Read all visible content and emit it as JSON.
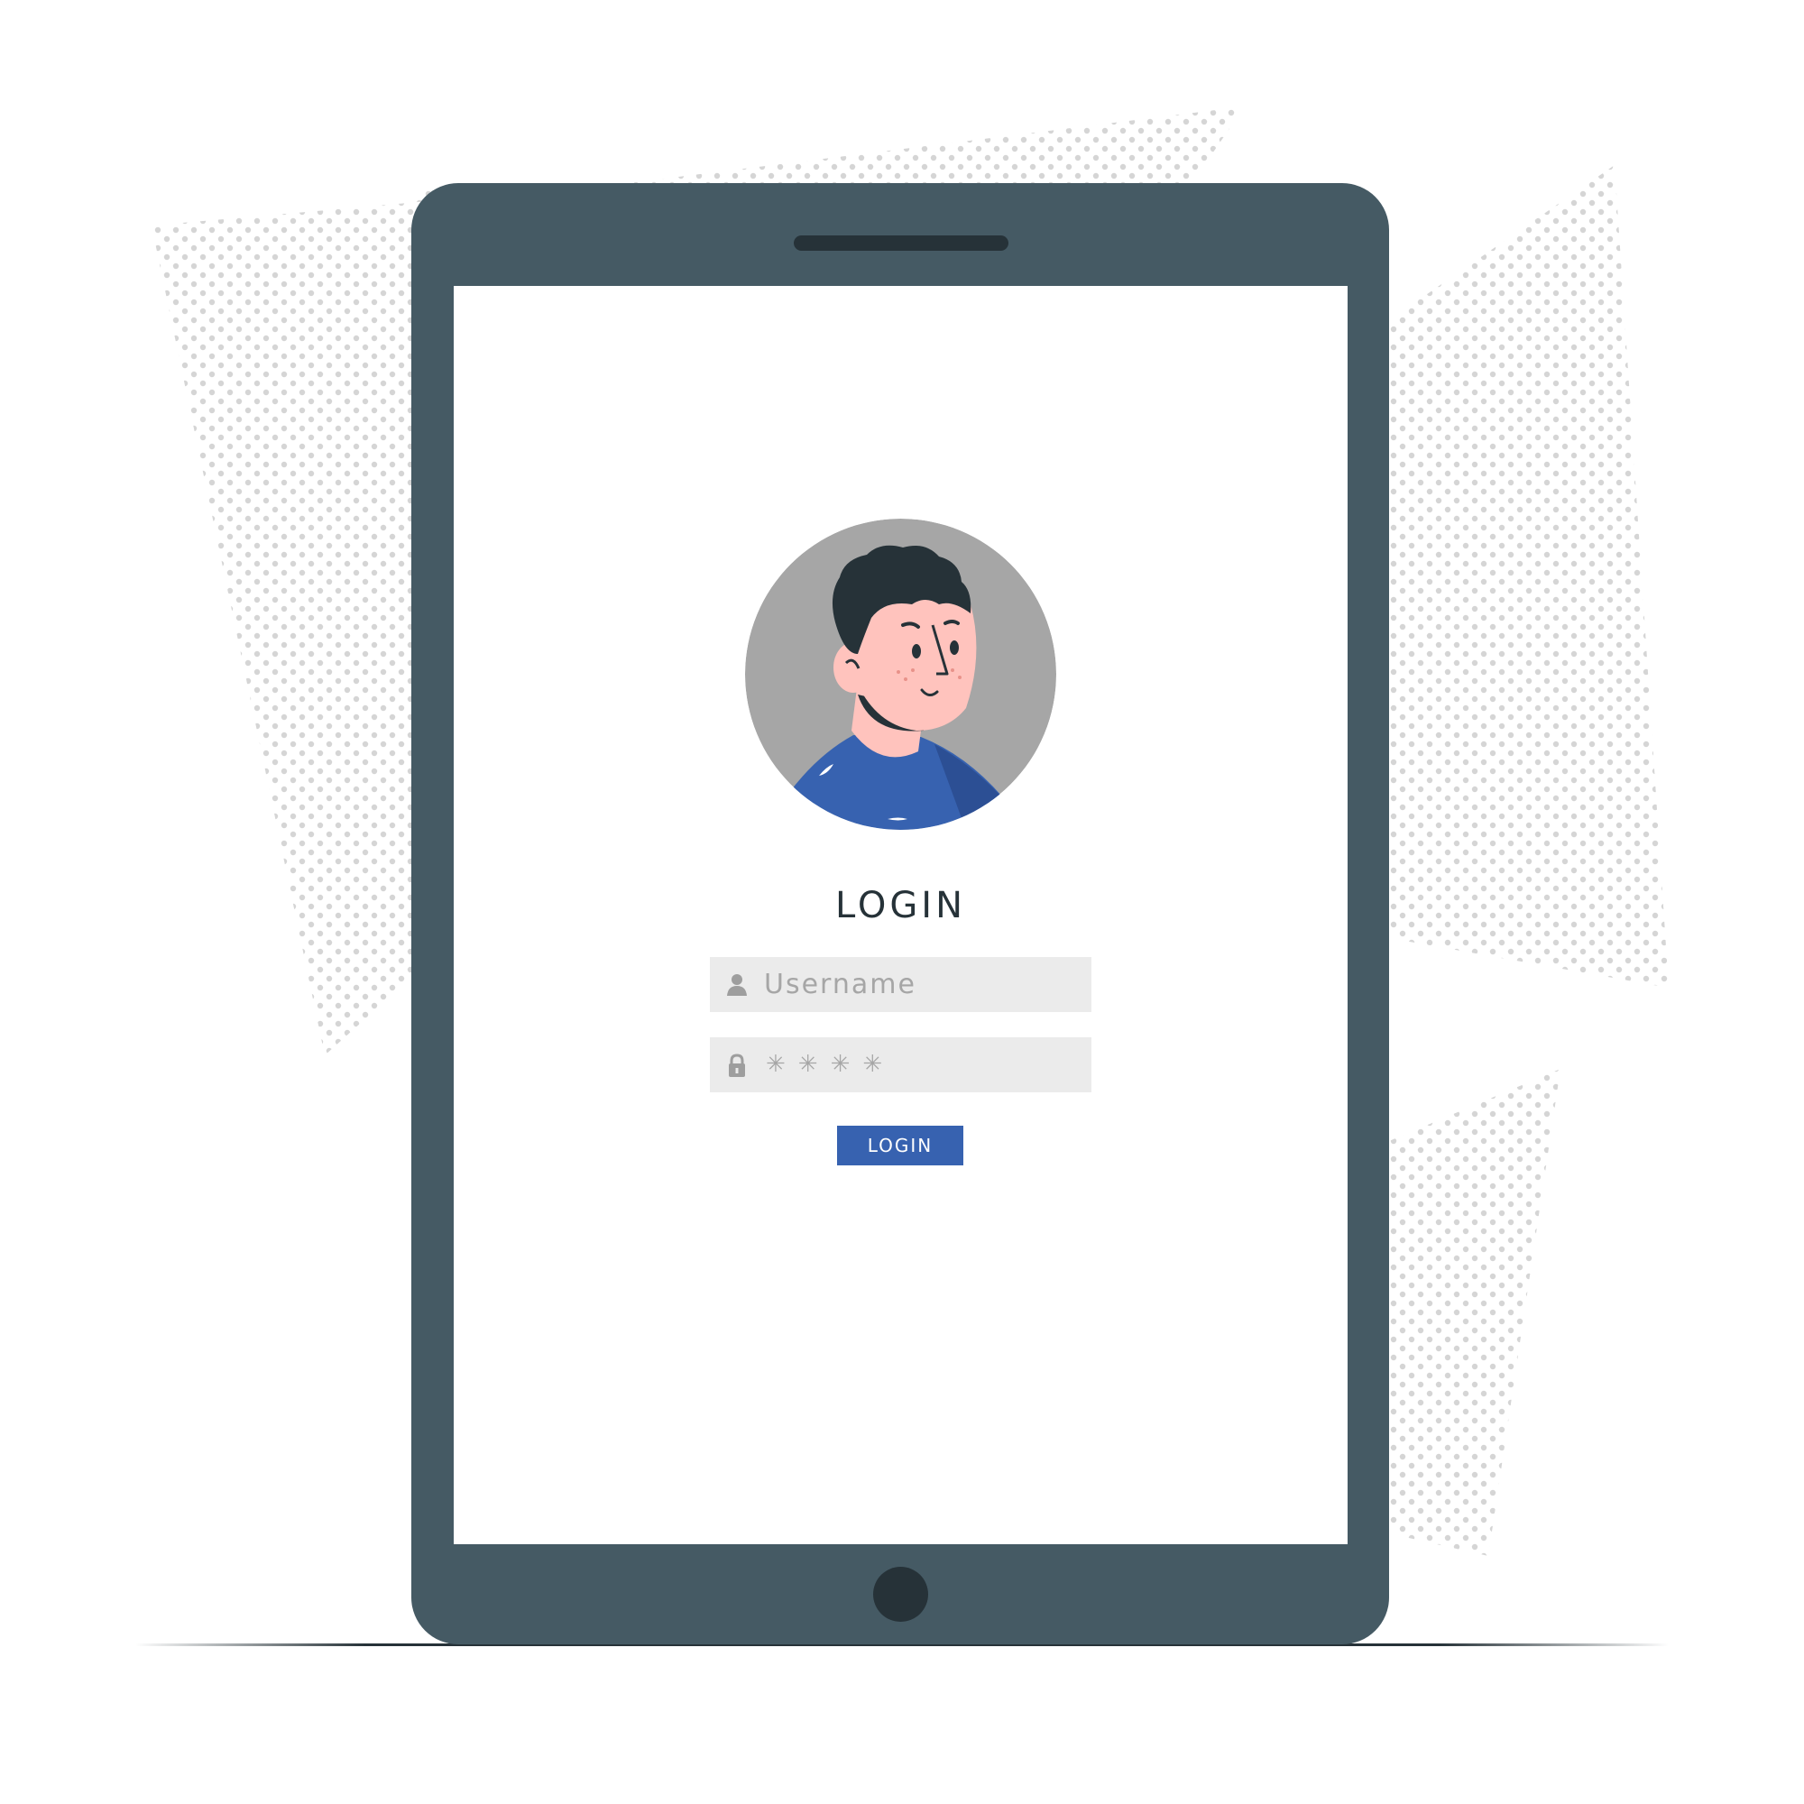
{
  "login": {
    "title": "LOGIN",
    "username_placeholder": "Username",
    "password_mask": "✳✳✳✳",
    "button_label": "LOGIN"
  },
  "icons": {
    "username": "user-icon",
    "password": "lock-icon",
    "avatar": "user-avatar"
  },
  "colors": {
    "device_frame": "#455a64",
    "device_dark": "#263238",
    "screen": "#ffffff",
    "input_background": "#ebebeb",
    "placeholder_text": "#a6a6a6",
    "primary_button": "#3762b0",
    "avatar_background": "#a6a6a6",
    "dot_pattern": "#d5d5d5"
  }
}
